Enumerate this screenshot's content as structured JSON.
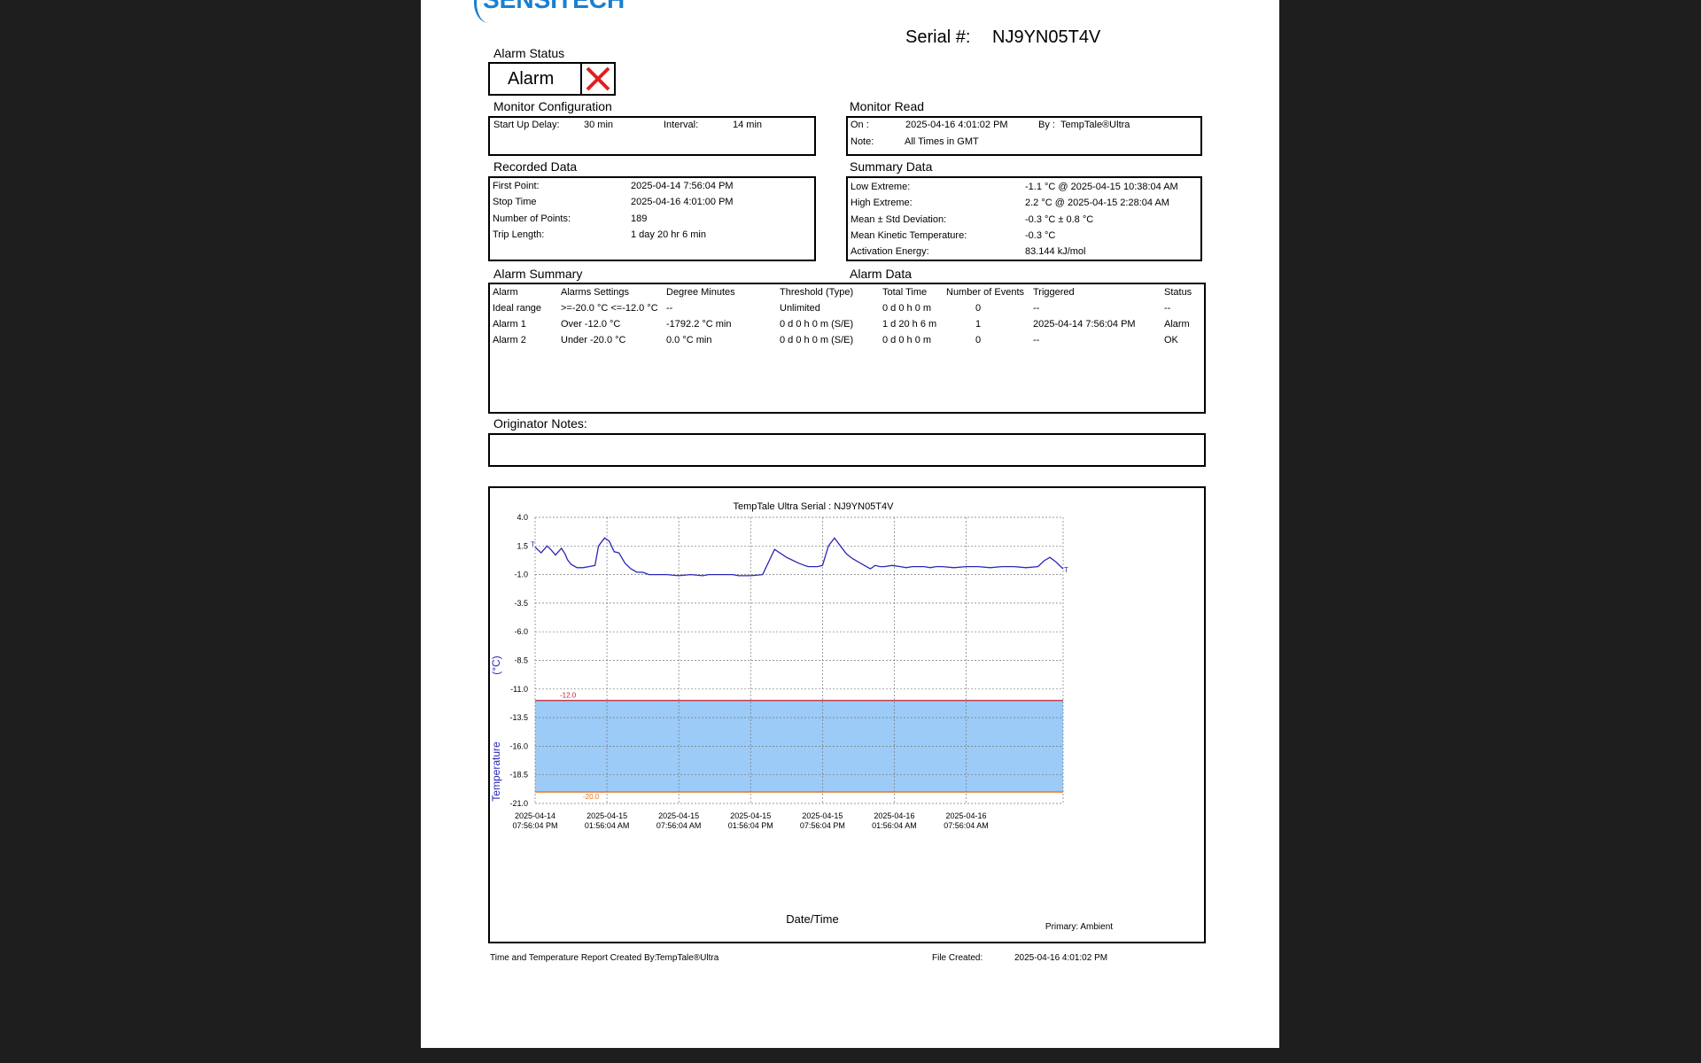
{
  "header": {
    "logo_text": "SENSITECH",
    "serial_label": "Serial #:",
    "serial_value": "NJ9YN05T4V"
  },
  "alarm_status": {
    "title": "Alarm Status",
    "value": "Alarm",
    "icon": "red-x-icon"
  },
  "monitor_config": {
    "title": "Monitor Configuration",
    "startup_label": "Start Up Delay:",
    "startup_value": "30 min",
    "interval_label": "Interval:",
    "interval_value": "14 min"
  },
  "monitor_read": {
    "title": "Monitor Read",
    "on_label": "On :",
    "on_value": "2025-04-16  4:01:02 PM",
    "by_label": "By :",
    "by_value": "TempTale®Ultra",
    "note_label": "Note:",
    "note_value": "All Times in GMT"
  },
  "recorded_data": {
    "title": "Recorded Data",
    "rows": [
      {
        "label": "First Point:",
        "value": "2025-04-14  7:56:04 PM"
      },
      {
        "label": "Stop Time",
        "value": "2025-04-16  4:01:00 PM"
      },
      {
        "label": "Number of Points:",
        "value": "189"
      },
      {
        "label": "Trip Length:",
        "value": "1 day 20 hr 6 min"
      }
    ]
  },
  "summary_data": {
    "title": "Summary Data",
    "rows": [
      {
        "label": "Low Extreme:",
        "value": "-1.1 °C @ 2025-04-15 10:38:04 AM"
      },
      {
        "label": "High Extreme:",
        "value": "2.2 °C @ 2025-04-15  2:28:04 AM"
      },
      {
        "label": "Mean ± Std Deviation:",
        "value": "-0.3 °C ± 0.8 °C"
      },
      {
        "label": "Mean Kinetic Temperature:",
        "value": "-0.3 °C"
      },
      {
        "label": "Activation Energy:",
        "value": "83.144 kJ/mol"
      }
    ]
  },
  "alarm_summary": {
    "title": "Alarm Summary",
    "data_title": "Alarm Data",
    "headers": [
      "Alarm",
      "Alarms Settings",
      "Degree Minutes",
      "Threshold (Type)",
      "Total Time",
      "Number of Events",
      "Triggered",
      "Status"
    ],
    "rows": [
      [
        "Ideal range",
        ">=-20.0 °C <=-12.0 °C",
        "--",
        "Unlimited",
        "0 d 0 h 0 m",
        "0",
        "--",
        "--"
      ],
      [
        "Alarm 1",
        "Over -12.0 °C",
        "-1792.2 °C min",
        "0 d 0 h 0 m (S/E)",
        "1 d 20 h 6 m",
        "1",
        "2025-04-14  7:56:04 PM",
        "Alarm"
      ],
      [
        "Alarm 2",
        "Under -20.0 °C",
        "0.0 °C min",
        "0 d 0 h 0 m (S/E)",
        "0 d 0 h 0 m",
        "0",
        "--",
        "OK"
      ]
    ]
  },
  "originator_notes": {
    "title": "Originator Notes:"
  },
  "chart_data": {
    "type": "line",
    "title": "TempTale Ultra  Serial : NJ9YN05T4V",
    "xlabel": "Date/Time",
    "ylabel": "Temperature",
    "ylabel_unit": "(°C)",
    "ylim": [
      -21.0,
      4.0
    ],
    "yticks": [
      "4.0",
      "1.5",
      "-1.0",
      "-3.5",
      "-6.0",
      "-8.5",
      "-11.0",
      "-13.5",
      "-16.0",
      "-18.5",
      "-21.0"
    ],
    "xticks": [
      {
        "date": "2025-04-14",
        "time": "07:56:04 PM"
      },
      {
        "date": "2025-04-15",
        "time": "01:56:04 AM"
      },
      {
        "date": "2025-04-15",
        "time": "07:56:04 AM"
      },
      {
        "date": "2025-04-15",
        "time": "01:56:04 PM"
      },
      {
        "date": "2025-04-15",
        "time": "07:56:04 PM"
      },
      {
        "date": "2025-04-16",
        "time": "01:56:04 AM"
      },
      {
        "date": "2025-04-16",
        "time": "07:56:04 AM"
      }
    ],
    "x_hours_range": [
      0,
      44.1
    ],
    "upper_limit": {
      "value": -12.0,
      "label": "-12.0",
      "color": "#c0262d"
    },
    "lower_limit": {
      "value": -20.0,
      "label": "-20.0",
      "color": "#e07020"
    },
    "ideal_band_color": "#9ccbf7",
    "grid": true,
    "series": [
      {
        "color": "#2b27b8",
        "start_marker": "T",
        "end_marker": "T",
        "x_hours": [
          0,
          0.5,
          1.0,
          1.3,
          1.7,
          2.2,
          2.5,
          2.7,
          3.0,
          3.5,
          4.0,
          4.5,
          5.0,
          5.3,
          5.8,
          6.2,
          6.6,
          7.0,
          7.5,
          8.0,
          8.5,
          9.0,
          9.5,
          10.0,
          11.0,
          12.0,
          13.0,
          14.0,
          14.5,
          15.0,
          15.5,
          16.0,
          16.5,
          17.0,
          18.0,
          19.0,
          20.0,
          21.0,
          22.0,
          22.5,
          22.8,
          23.2,
          23.6,
          24.0,
          24.5,
          25.0,
          25.5,
          26.0,
          26.5,
          27.0,
          27.5,
          28.0,
          28.4,
          28.8,
          29.2,
          29.8,
          30.5,
          31.0,
          31.5,
          32.0,
          32.5,
          33.0,
          33.5,
          34.0,
          35.0,
          36.0,
          37.0,
          38.0,
          39.0,
          40.0,
          41.0,
          42.0,
          42.5,
          43.0,
          43.5,
          44.1
        ],
        "values": [
          1.4,
          0.9,
          1.5,
          1.2,
          0.7,
          1.3,
          0.8,
          0.3,
          -0.1,
          -0.4,
          -0.4,
          -0.3,
          -0.2,
          1.5,
          2.2,
          1.9,
          1.0,
          0.9,
          0.0,
          -0.5,
          -0.8,
          -0.8,
          -1.0,
          -1.0,
          -1.0,
          -1.1,
          -1.0,
          -1.1,
          -1.0,
          -1.0,
          -1.0,
          -1.0,
          -1.0,
          -1.1,
          -1.1,
          -1.0,
          1.2,
          0.5,
          0.0,
          -0.2,
          -0.3,
          -0.3,
          -0.3,
          -0.2,
          1.5,
          2.2,
          1.5,
          0.8,
          0.4,
          0.1,
          -0.2,
          -0.5,
          -0.2,
          -0.3,
          -0.3,
          -0.2,
          -0.3,
          -0.4,
          -0.3,
          -0.3,
          -0.3,
          -0.4,
          -0.3,
          -0.3,
          -0.4,
          -0.3,
          -0.3,
          -0.4,
          -0.3,
          -0.3,
          -0.4,
          -0.3,
          0.2,
          0.5,
          0.1,
          -0.5
        ]
      }
    ],
    "legend_note": "Primary: Ambient"
  },
  "footer": {
    "created_by_label": "Time and Temperature Report Created By:",
    "created_by_value": "TempTale®Ultra",
    "file_created_label": "File Created:",
    "file_created_value": "2025-04-16  4:01:02 PM"
  }
}
